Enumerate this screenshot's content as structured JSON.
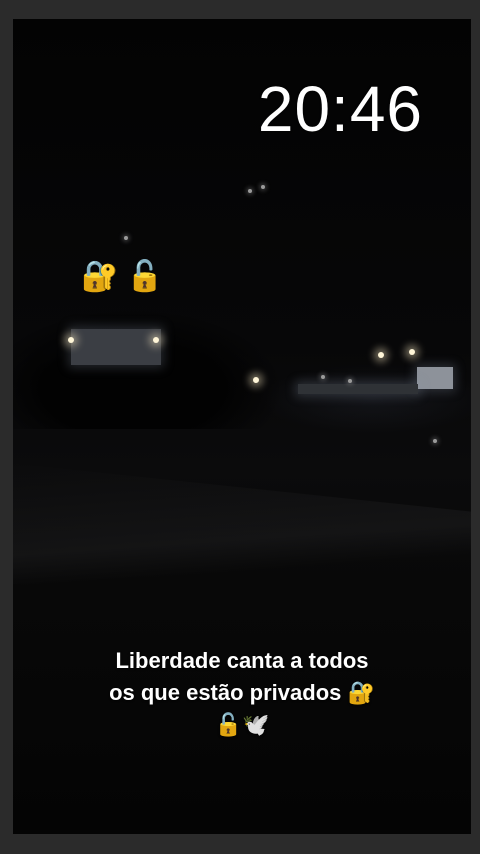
{
  "story": {
    "time": "20:46",
    "stickers": [
      "🔐",
      "🔓"
    ],
    "caption": {
      "line1": "Liberdade canta a todos",
      "line2": "os que estão privados",
      "line2_emoji": "🔐",
      "line3_emojis": "🔓🕊️"
    }
  },
  "colors": {
    "background": "#050505",
    "text": "#ffffff",
    "outer_border": "#2b2b2b"
  }
}
